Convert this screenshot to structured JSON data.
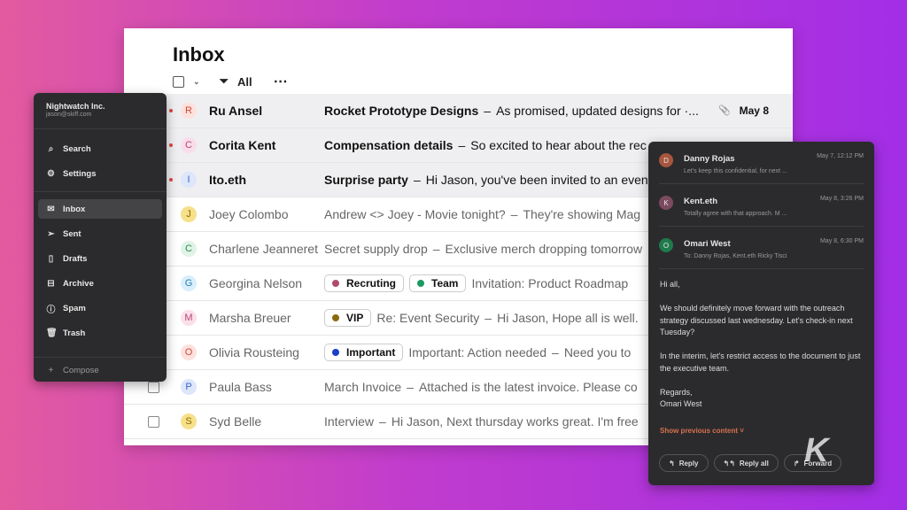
{
  "inbox": {
    "title": "Inbox",
    "filter_label": "All",
    "rows": [
      {
        "name": "Ru Ansel",
        "initial": "R",
        "av_bg": "#fde1dd",
        "av_fg": "#d04a3a",
        "unread": true,
        "subject": "Rocket Prototype Designs",
        "preview": "As promised, updated designs for ·...",
        "date": "May 8",
        "attachment": true,
        "tags": []
      },
      {
        "name": "Corita Kent",
        "initial": "C",
        "av_bg": "#f9dde9",
        "av_fg": "#b5487a",
        "unread": true,
        "subject": "Compensation details",
        "preview": "So excited to hear about the rec",
        "tags": []
      },
      {
        "name": "Ito.eth",
        "initial": "I",
        "av_bg": "#dde6fb",
        "av_fg": "#3c63c9",
        "unread": true,
        "subject": "Surprise party",
        "preview": "Hi Jason, you've been invited to an event",
        "tags": []
      },
      {
        "name": "Joey Colombo",
        "initial": "J",
        "av_bg": "#f6e08a",
        "av_fg": "#8a6a00",
        "subject": "Andrew <> Joey - Movie tonight?",
        "preview": "They're showing Mag",
        "tags": []
      },
      {
        "name": "Charlene Jeanneret",
        "initial": "C",
        "av_bg": "#dff3e6",
        "av_fg": "#2e8a52",
        "subject": "Secret supply drop",
        "preview": "Exclusive merch dropping tomorrow",
        "tags": []
      },
      {
        "name": "Georgina Nelson",
        "initial": "G",
        "av_bg": "#d9effb",
        "av_fg": "#2a7fb5",
        "subject": "Invitation: Product Roadmap",
        "preview": "",
        "tags": [
          {
            "label": "Recruting",
            "color": "#b04a6e"
          },
          {
            "label": "Team",
            "color": "#1a9a62"
          }
        ]
      },
      {
        "name": "Marsha Breuer",
        "initial": "M",
        "av_bg": "#fbe0ea",
        "av_fg": "#b5487a",
        "subject": "Re: Event Security",
        "preview": "Hi Jason, Hope all is well.",
        "tags": [
          {
            "label": "VIP",
            "color": "#8a6a10"
          }
        ]
      },
      {
        "name": "Olivia Rousteing",
        "initial": "O",
        "av_bg": "#fde1dd",
        "av_fg": "#d04a3a",
        "subject": "Important: Action needed",
        "preview": "Need you to",
        "tags": [
          {
            "label": "Important",
            "color": "#1a3fc9"
          }
        ]
      },
      {
        "name": "Paula Bass",
        "initial": "P",
        "av_bg": "#dde6fb",
        "av_fg": "#3c63c9",
        "subject": "March Invoice",
        "preview": "Attached is the latest invoice. Please co",
        "tags": [],
        "checkbox": true
      },
      {
        "name": "Syd Belle",
        "initial": "S",
        "av_bg": "#f6e08a",
        "av_fg": "#8a6a00",
        "subject": "Interview",
        "preview": "Hi Jason, Next thursday works great. I'm free",
        "tags": [],
        "checkbox": true
      }
    ]
  },
  "sidebar": {
    "org": "Nightwatch Inc.",
    "email": "jason@skiff.com",
    "items": [
      {
        "label": "Search",
        "icon": "⌕"
      },
      {
        "label": "Settings",
        "icon": "⚙"
      },
      {
        "label": "Inbox",
        "icon": "✉"
      },
      {
        "label": "Sent",
        "icon": "➢"
      },
      {
        "label": "Drafts",
        "icon": "▯"
      },
      {
        "label": "Archive",
        "icon": "⊟"
      },
      {
        "label": "Spam",
        "icon": "ⓘ"
      },
      {
        "label": "Trash",
        "icon": "🗑"
      }
    ],
    "compose": "Compose"
  },
  "reader": {
    "messages": [
      {
        "name": "Danny Rojas",
        "initial": "D",
        "color": "#a8553f",
        "time": "May 7, 12:12 PM",
        "preview": "Let's keep this confidential, for next  ..."
      },
      {
        "name": "Kent.eth",
        "initial": "K",
        "color": "#7c4a5e",
        "time": "May 8, 3:26 PM",
        "preview": "Totally agree with that approach. M  ..."
      },
      {
        "name": "Omari West",
        "initial": "O",
        "color": "#1f7a4c",
        "time": "May 8, 6:30 PM",
        "preview": "To:   Danny Rojas,   Kent.eth   Ricky Tisci"
      }
    ],
    "body": [
      "Hi all,",
      "We should definitely move forward with the outreach strategy discussed last wednesday. Let's check-in next Tuesday?",
      "In the interim, let's restrict access to the document to just the executive team.",
      "Regards,\nOmari West"
    ],
    "show_previous": "Show previous content ˅",
    "reply": "Reply",
    "reply_all": "Reply all",
    "forward": "Forward"
  },
  "watermark": "K"
}
